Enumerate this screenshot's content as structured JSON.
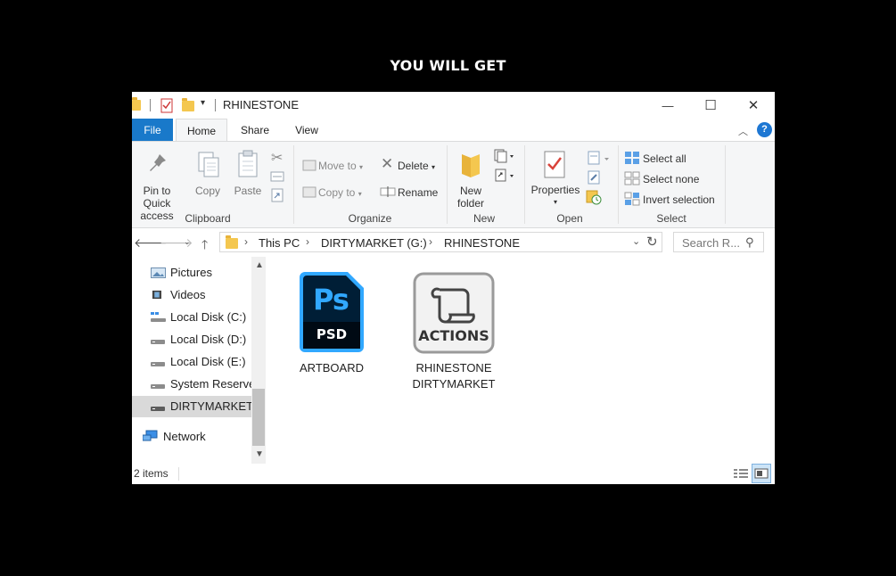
{
  "headline": "YOU WILL GET",
  "window": {
    "title": "RHINESTONE",
    "controls": {
      "minimize": "—",
      "maximize": "☐",
      "close": "✕"
    }
  },
  "ribbon_tabs": {
    "file": "File",
    "home": "Home",
    "share": "Share",
    "view": "View",
    "help": "?"
  },
  "ribbon": {
    "clipboard": {
      "pin": "Pin to Quick access",
      "pin_line1": "Pin to Quick",
      "pin_line2": "access",
      "copy": "Copy",
      "paste": "Paste",
      "group": "Clipboard"
    },
    "organize": {
      "move_to": "Move to",
      "copy_to": "Copy to",
      "delete": "Delete",
      "rename": "Rename",
      "group": "Organize"
    },
    "new": {
      "new_folder_line1": "New",
      "new_folder_line2": "folder",
      "group": "New"
    },
    "open": {
      "properties": "Properties",
      "group": "Open"
    },
    "select": {
      "select_all": "Select all",
      "select_none": "Select none",
      "invert": "Invert selection",
      "group": "Select"
    }
  },
  "address": {
    "crumbs": [
      "This PC",
      "DIRTYMARKET (G:)",
      "RHINESTONE"
    ],
    "search_placeholder": "Search R..."
  },
  "nav_pane": {
    "items": [
      {
        "label": "Pictures",
        "icon": "pictures-icon"
      },
      {
        "label": "Videos",
        "icon": "videos-icon"
      },
      {
        "label": "Local Disk (C:)",
        "icon": "system-drive-icon"
      },
      {
        "label": "Local Disk (D:)",
        "icon": "drive-icon"
      },
      {
        "label": "Local Disk (E:)",
        "icon": "drive-icon"
      },
      {
        "label": "System Reserved",
        "icon": "drive-icon"
      },
      {
        "label": "DIRTYMARKET",
        "icon": "drive-icon",
        "selected": true
      }
    ],
    "network": "Network"
  },
  "files": [
    {
      "name": "ARTBOARD",
      "icon": "psd-file-icon",
      "badge_top": "Ps",
      "badge_bottom": "PSD"
    },
    {
      "name_line1": "RHINESTONE",
      "name_line2": "DIRTYMARKET",
      "icon": "actions-file-icon",
      "badge_bottom": "ACTIONS"
    }
  ],
  "status": {
    "count": "2 items"
  },
  "colors": {
    "file_tab": "#1979ca",
    "ps_blue": "#31a8ff",
    "ps_bg": "#001e36",
    "folder": "#f4c74f"
  }
}
